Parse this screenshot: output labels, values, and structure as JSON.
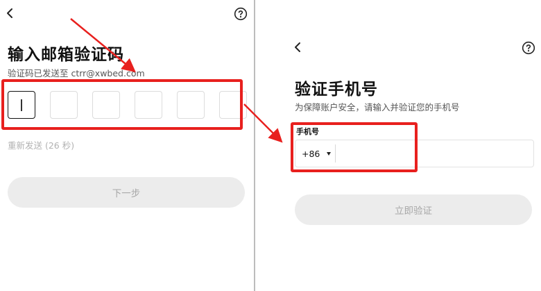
{
  "left": {
    "title": "输入邮箱验证码",
    "subtitle": "验证码已发送至 ctrr@xwbed.com",
    "code_box_count": 6,
    "resend": "重新发送 (26 秒)",
    "next_button": "下一步"
  },
  "right": {
    "title": "验证手机号",
    "subtitle": "为保障账户安全，请输入并验证您的手机号",
    "phone_label": "手机号",
    "country_code": "+86",
    "phone_value": "",
    "verify_button": "立即验证"
  },
  "colors": {
    "annotation": "#e8201e",
    "disabled_button_bg": "#ececec",
    "disabled_button_text": "#a8a8a8",
    "active_border": "#111111"
  },
  "icons": [
    "back-icon",
    "help-icon",
    "dropdown-caret-icon"
  ]
}
